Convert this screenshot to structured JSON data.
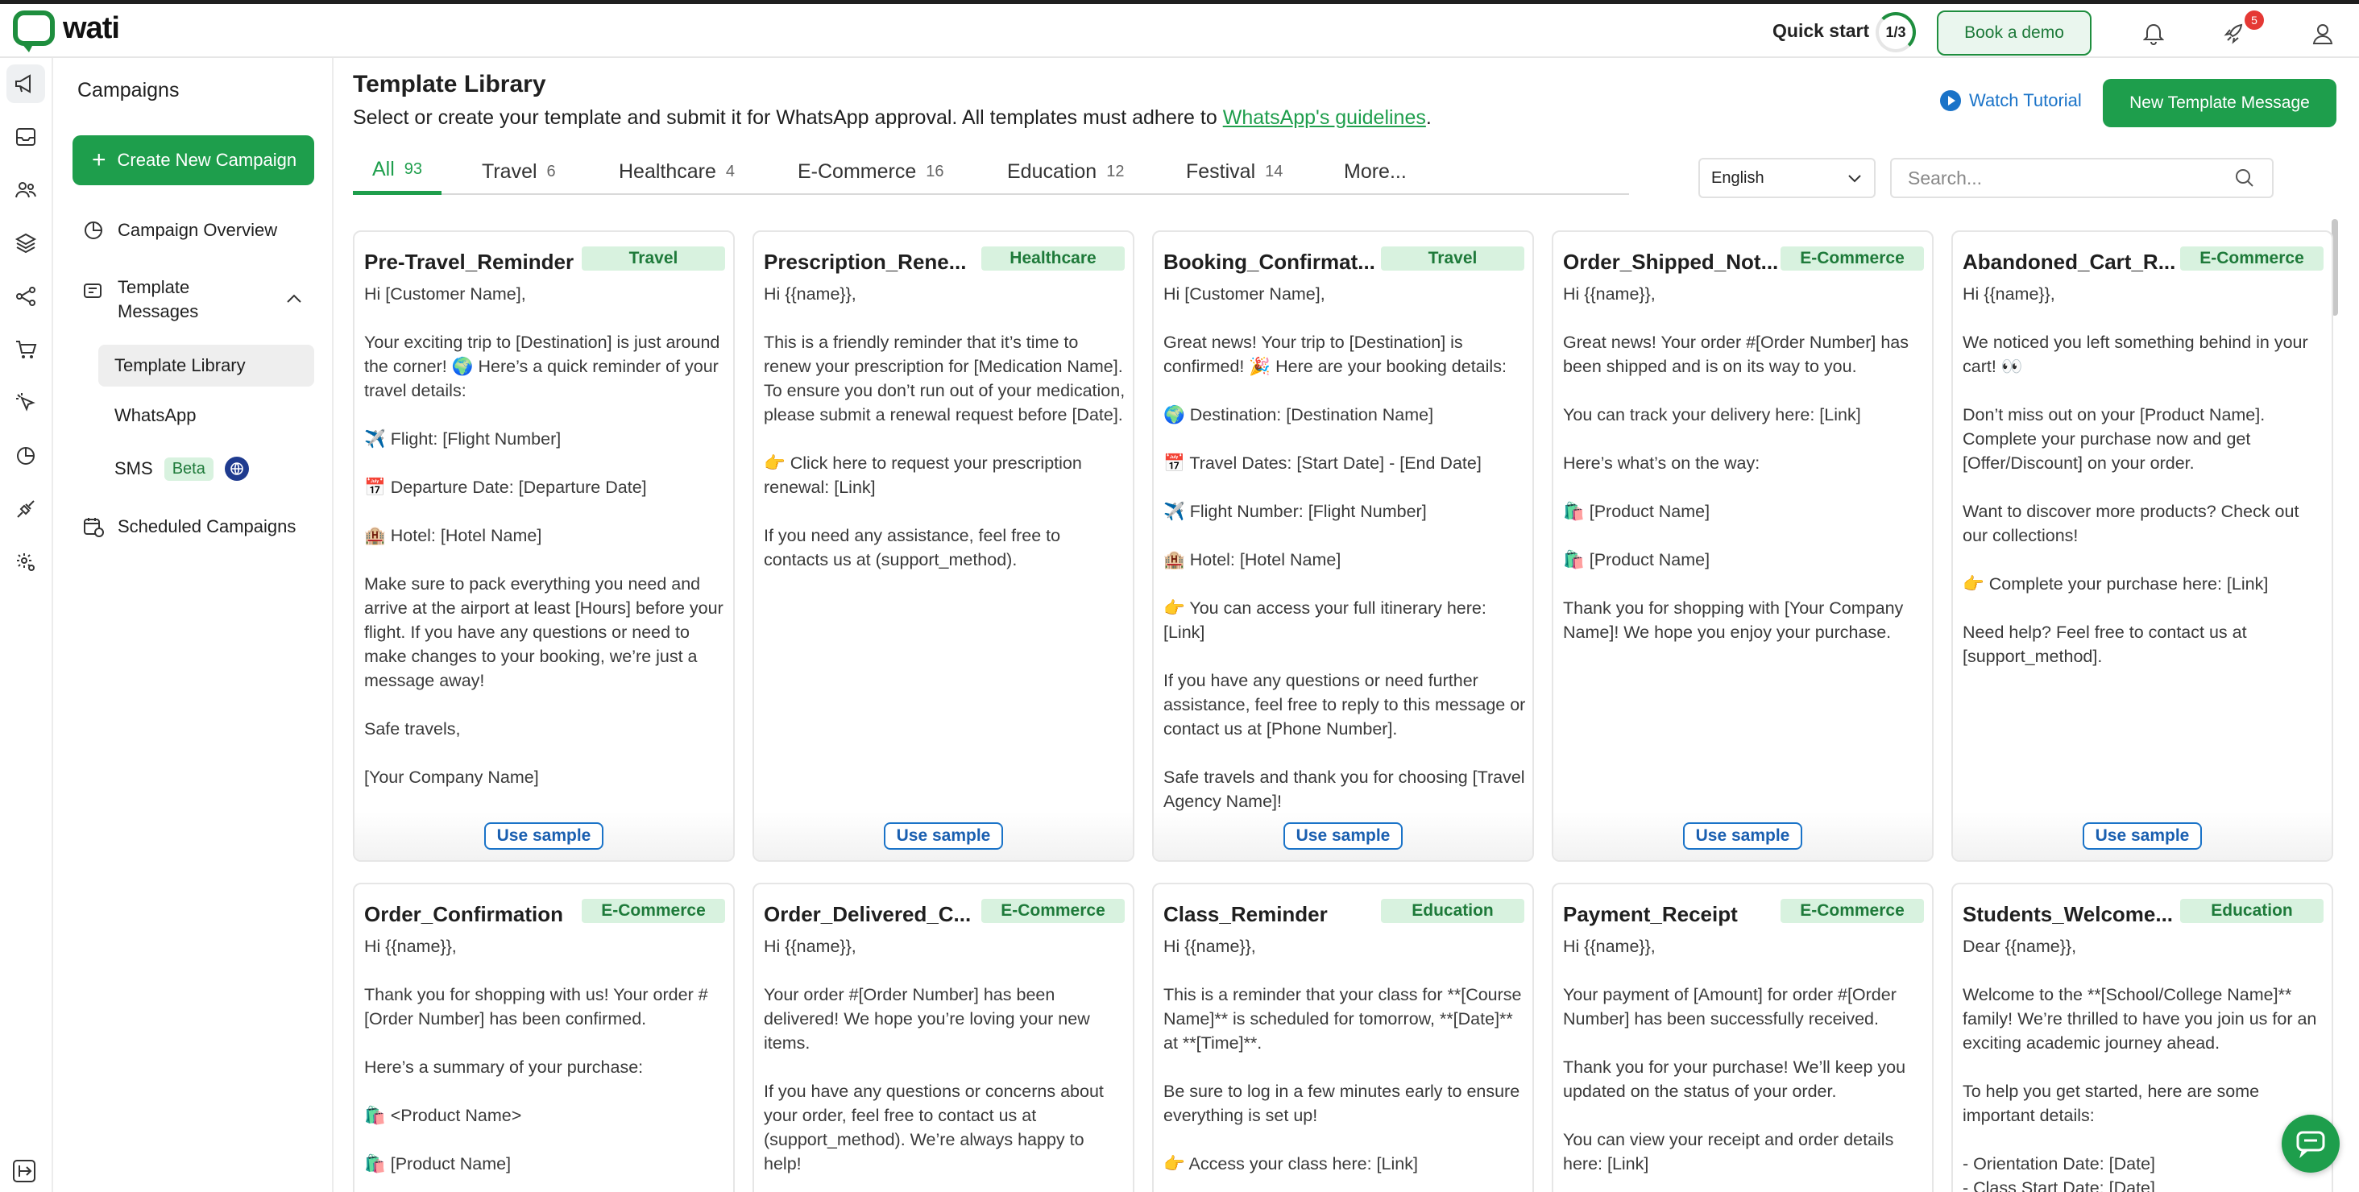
{
  "header": {
    "logo_text": "wati",
    "quick_start_label": "Quick start",
    "quick_start_progress": "1/3",
    "book_demo_label": "Book a demo",
    "notification_count": "5"
  },
  "sidebar": {
    "title": "Campaigns",
    "create_label": "Create New Campaign",
    "campaign_overview": "Campaign Overview",
    "template_messages": "Template Messages",
    "template_library": "Template Library",
    "whatsapp": "WhatsApp",
    "sms": "SMS",
    "sms_badge": "Beta",
    "scheduled_campaigns": "Scheduled Campaigns"
  },
  "main": {
    "title": "Template Library",
    "subtitle": "Select or create your template and submit it for WhatsApp approval. All templates must adhere to",
    "subtitle_link": "WhatsApp's guidelines",
    "subtitle_end": ".",
    "watch_tutorial": "Watch Tutorial",
    "new_template": "New Template Message",
    "tabs": [
      {
        "label": "All",
        "count": "93"
      },
      {
        "label": "Travel",
        "count": "6"
      },
      {
        "label": "Healthcare",
        "count": "4"
      },
      {
        "label": "E-Commerce",
        "count": "16"
      },
      {
        "label": "Education",
        "count": "12"
      },
      {
        "label": "Festival",
        "count": "14"
      },
      {
        "label": "More...",
        "count": ""
      }
    ],
    "language": "English",
    "search_placeholder": "Search...",
    "use_sample_label": "Use sample"
  },
  "cards": [
    {
      "title": "Pre-Travel_Reminder",
      "tag": "Travel",
      "body": [
        "Hi [Customer Name],",
        "Your exciting trip to [Destination] is just around the corner! 🌍 Here’s a quick reminder of your travel details:",
        "✈️ Flight: [Flight Number]",
        "📅 Departure Date: [Departure Date]",
        "🏨 Hotel: [Hotel Name]",
        "Make sure to pack everything you need and arrive at the airport at least [Hours] before your flight. If you have any questions or need to make changes to your booking, we’re just a message away!",
        "Safe travels,",
        "[Your Company Name]"
      ]
    },
    {
      "title": "Prescription_Rene...",
      "tag": "Healthcare",
      "body": [
        "Hi {{name}},",
        "This is a friendly reminder that it’s time to renew your prescription for [Medication Name]. To ensure you don’t run out of your medication, please submit a renewal request before [Date].",
        "👉 Click here to request your prescription renewal: [Link]",
        "If you need any assistance, feel free to contacts us at (support_method)."
      ]
    },
    {
      "title": "Booking_Confirmat...",
      "tag": "Travel",
      "body": [
        "Hi [Customer Name],",
        "Great news! Your trip to [Destination] is confirmed! 🎉 Here are your booking details:",
        "🌍 Destination: [Destination Name]",
        "📅 Travel Dates: [Start Date] - [End Date]",
        "✈️ Flight Number: [Flight Number]",
        "🏨 Hotel: [Hotel Name]",
        "👉 You can access your full itinerary here: [Link]",
        "If you have any questions or need further assistance, feel free to reply to this message or contact us at [Phone Number].",
        "Safe travels and thank you for choosing [Travel Agency Name]!"
      ]
    },
    {
      "title": "Order_Shipped_Not...",
      "tag": "E-Commerce",
      "body": [
        "Hi {{name}},",
        "Great news! Your order #[Order Number] has been shipped and is on its way to you.",
        "You can track your delivery here: [Link]",
        "Here’s what’s on the way:",
        "🛍️ [Product Name]",
        "🛍️ [Product Name]",
        "Thank you for shopping with [Your Company Name]! We hope you enjoy your purchase."
      ]
    },
    {
      "title": "Abandoned_Cart_R...",
      "tag": "E-Commerce",
      "body": [
        "Hi {{name}},",
        "We noticed you left something behind in your cart! 👀",
        "Don’t miss out on your [Product Name]. Complete your purchase now and get [Offer/Discount] on your order.",
        "Want to discover more products? Check out our collections!",
        "👉 Complete your purchase here: [Link]",
        "Need help? Feel free to contact us at [support_method]."
      ]
    },
    {
      "title": "Order_Confirmation",
      "tag": "E-Commerce",
      "body": [
        "Hi {{name}},",
        "Thank you for shopping with us! Your order #[Order Number] has been confirmed.",
        "Here’s a summary of your purchase:",
        "🛍️ <Product Name>",
        "🛍️ [Product Name]"
      ]
    },
    {
      "title": "Order_Delivered_C...",
      "tag": "E-Commerce",
      "body": [
        "Hi {{name}},",
        "Your order #[Order Number] has been delivered! We hope you’re loving your new items.",
        "If you have any questions or concerns about your order, feel free to contact us at (support_method). We’re always happy to help!"
      ]
    },
    {
      "title": "Class_Reminder",
      "tag": "Education",
      "body": [
        "Hi {{name}},",
        "This is a reminder that your class for **[Course Name]** is scheduled for tomorrow, **[Date]** at **[Time]**.",
        "Be sure to log in a few minutes early to ensure everything is set up!",
        "👉 Access your class here: [Link]"
      ]
    },
    {
      "title": "Payment_Receipt",
      "tag": "E-Commerce",
      "body": [
        "Hi {{name}},",
        "Your payment of [Amount] for order #[Order Number] has been successfully received.",
        "Thank you for your purchase! We’ll keep you updated on the status of your order.",
        "You can view your receipt and order details here: [Link]"
      ]
    },
    {
      "title": "Students_Welcome...",
      "tag": "Education",
      "body": [
        "Dear {{name}},",
        "Welcome to the **[School/College Name]** family! We’re thrilled to have you join us for an exciting academic journey ahead.",
        "To help you get started, here are some important details:",
        "- Orientation Date: [Date]\n- Class Start Date: [Date]"
      ]
    }
  ]
}
